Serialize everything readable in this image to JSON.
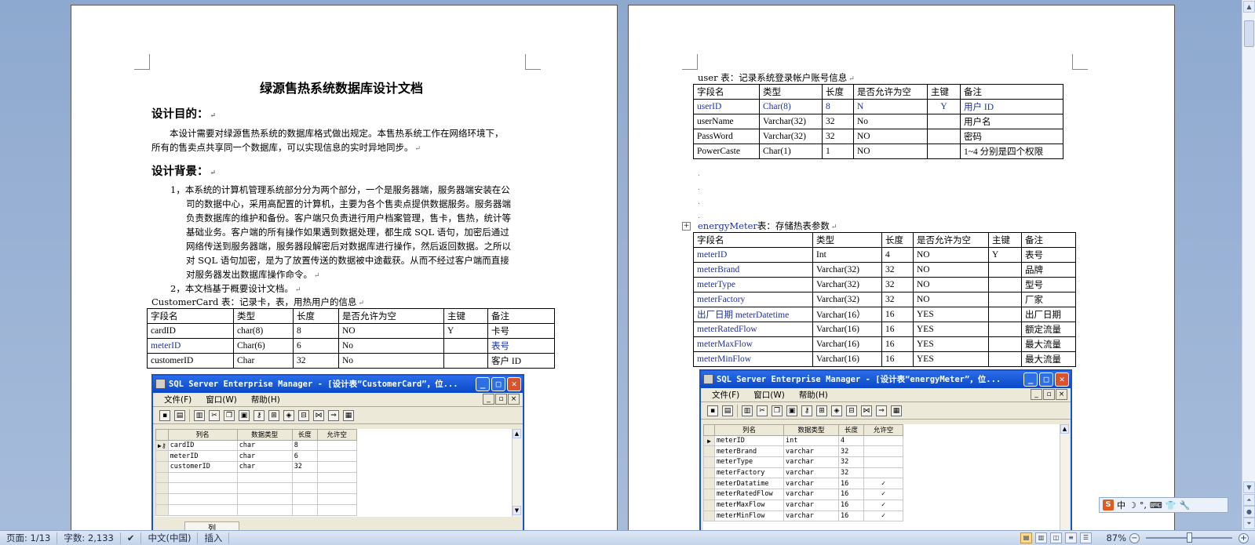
{
  "document": {
    "title": "绿源售热系统数据库设计文档",
    "purpose_heading": "设计目的：",
    "purpose_lines": [
      "本设计需要对绿源售热系统的数据库格式做出规定。本售热系统工作在网络环境下，",
      "所有的售卖点共享同一个数据库，可以实现信息的实时异地同步。"
    ],
    "background_heading": "设计背景：",
    "background_item1_lines": [
      "1，本系统的计算机管理系统部分分为两个部分，一个是服务器端，服务器端安装在公",
      "司的数据中心，采用高配置的计算机，主要为各个售卖点提供数据服务。服务器端",
      "负责数据库的维护和备份。客户端只负责进行用户档案管理，售卡，售热，统计等",
      "基础业务。客户端的所有操作如果遇到数据处理，都生成 SQL 语句，加密后通过",
      "网络传送到服务器端，服务器段解密后对数据库进行操作，然后返回数据。之所以",
      "对 SQL 语句加密，是为了放置传送的数据被中途截获。从而不经过客户端而直接",
      "对服务器发出数据库操作命令。"
    ],
    "background_item2": "2，本文档基于概要设计文档。",
    "paragraph_mark": "↵"
  },
  "customer_card": {
    "caption": "CustomerCard 表：记录卡，表，用热用户的信息",
    "headers": [
      "字段名",
      "类型",
      "长度",
      "是否允许为空",
      "主键",
      "备注"
    ],
    "rows": [
      [
        "cardID",
        "char(8)",
        "8",
        "NO",
        "Y",
        "卡号"
      ],
      [
        "meterID",
        "Char(6)",
        "6",
        "No",
        "",
        "表号"
      ],
      [
        "customerID",
        "Char",
        "32",
        "No",
        "",
        "客户 ID"
      ]
    ]
  },
  "user_table": {
    "caption": "user 表：记录系统登录帐户账号信息",
    "headers": [
      "字段名",
      "类型",
      "长度",
      "是否允许为空",
      "主键",
      "备注"
    ],
    "rows": [
      [
        "userID",
        "Char(8)",
        "8",
        "N",
        "Y",
        "用户 ID"
      ],
      [
        "userName",
        "Varchar(32)",
        "32",
        "No",
        "",
        "用户名"
      ],
      [
        "PassWord",
        "Varchar(32)",
        "32",
        "NO",
        "",
        "密码"
      ],
      [
        "PowerCaste",
        "Char(1)",
        "1",
        "NO",
        "",
        "1~4 分别是四个权限"
      ]
    ]
  },
  "energy_meter": {
    "caption_name": "energyMeter",
    "caption_rest": "表：存储热表参数",
    "headers": [
      "字段名",
      "类型",
      "长度",
      "是否允许为空",
      "主键",
      "备注"
    ],
    "rows": [
      [
        "meterID",
        "Int",
        "4",
        "NO",
        "Y",
        "表号"
      ],
      [
        "meterBrand",
        "Varchar(32)",
        "32",
        "NO",
        "",
        "品牌"
      ],
      [
        "meterType",
        "Varchar(32)",
        "32",
        "NO",
        "",
        "型号"
      ],
      [
        "meterFactory",
        "Varchar(32)",
        "32",
        "NO",
        "",
        "厂家"
      ],
      [
        "出厂日期 meterDatetime",
        "Varchar(16）",
        "16",
        "YES",
        "",
        "出厂日期"
      ],
      [
        "meterRatedFlow",
        "Varchar(16)",
        "16",
        "YES",
        "",
        "额定流量"
      ],
      [
        "meterMaxFlow",
        "Varchar(16)",
        "16",
        "YES",
        "",
        "最大流量"
      ],
      [
        "meterMinFlow",
        "Varchar(16)",
        "16",
        "YES",
        "",
        "最大流量"
      ]
    ]
  },
  "sql_window_left": {
    "title": "SQL Server Enterprise Manager - [设计表“CustomerCard”，位...",
    "menu": [
      "文件(F)",
      "窗口(W)",
      "帮助(H)"
    ],
    "grid_headers": [
      "列名",
      "数据类型",
      "长度",
      "允许空"
    ],
    "grid_rows": [
      [
        "cardID",
        "char",
        "8",
        ""
      ],
      [
        "meterID",
        "char",
        "6",
        ""
      ],
      [
        "customerID",
        "char",
        "32",
        ""
      ]
    ],
    "bottom_tab": "列"
  },
  "sql_window_right": {
    "title": "SQL Server Enterprise Manager - [设计表“energyMeter”，位...",
    "menu": [
      "文件(F)",
      "窗口(W)",
      "帮助(H)"
    ],
    "grid_headers": [
      "列名",
      "数据类型",
      "长度",
      "允许空"
    ],
    "grid_rows": [
      [
        "meterID",
        "int",
        "4",
        ""
      ],
      [
        "meterBrand",
        "varchar",
        "32",
        ""
      ],
      [
        "meterType",
        "varchar",
        "32",
        ""
      ],
      [
        "meterFactory",
        "varchar",
        "32",
        ""
      ],
      [
        "meterDatatime",
        "varchar",
        "16",
        "✓"
      ],
      [
        "meterRatedFlow",
        "varchar",
        "16",
        "✓"
      ],
      [
        "meterMaxFlow",
        "varchar",
        "16",
        "✓"
      ],
      [
        "meterMinFlow",
        "varchar",
        "16",
        "✓"
      ]
    ]
  },
  "ime_bar": {
    "logo": "S",
    "items": [
      "中",
      "☽",
      "°,",
      "⌨",
      "👕",
      "🔧"
    ]
  },
  "status": {
    "page": "页面: 1/13",
    "words": "字数: 2,133",
    "language": "中文(中国)",
    "mode": "插入",
    "zoom": "87%"
  }
}
